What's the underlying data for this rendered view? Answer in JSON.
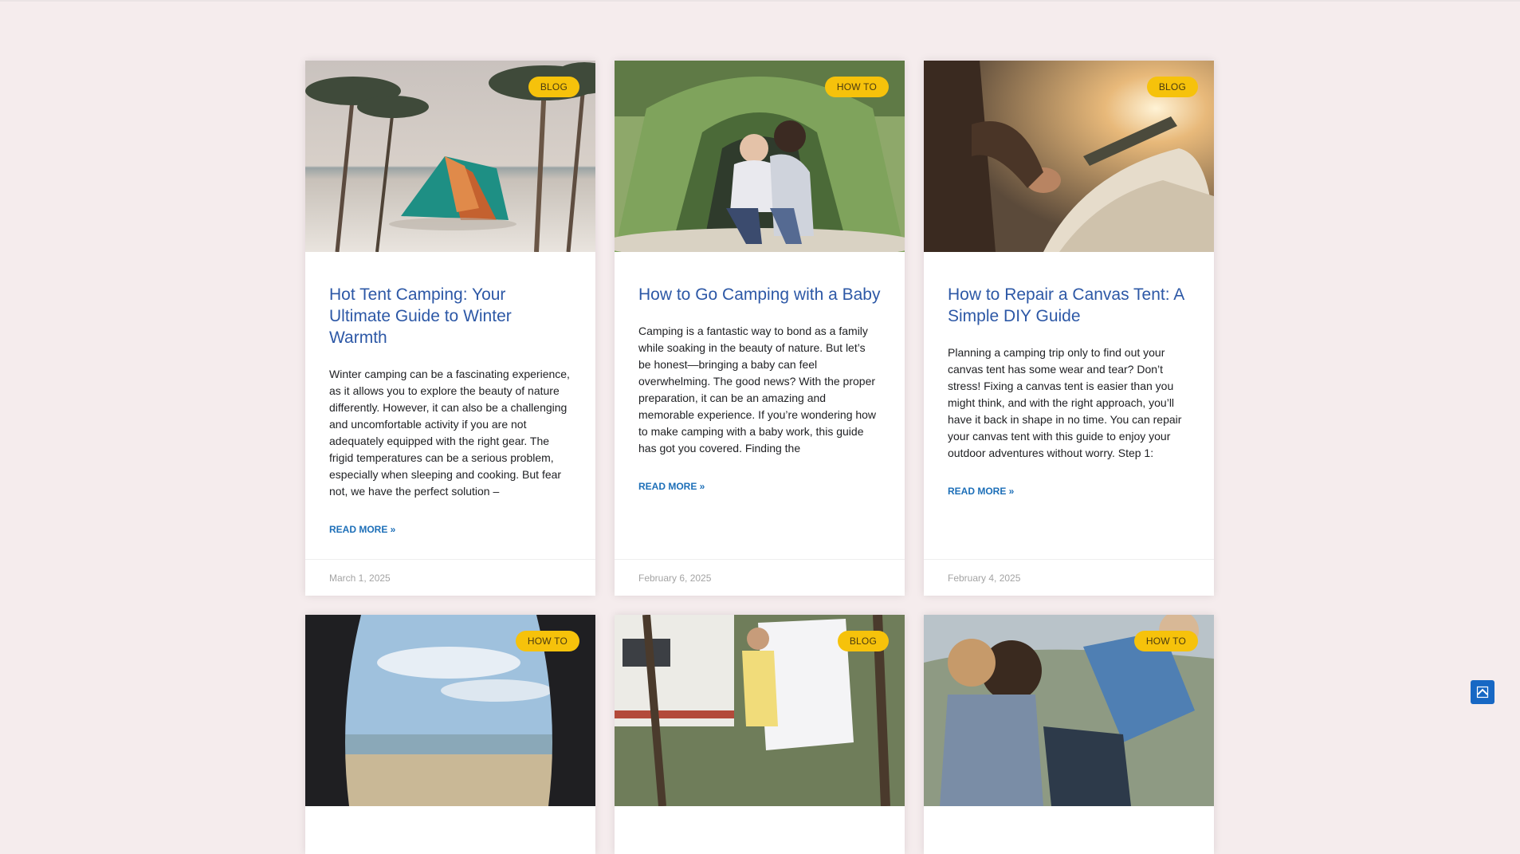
{
  "posts": [
    {
      "category": "BLOG",
      "title": "Hot Tent Camping: Your Ultimate Guide to Winter Warmth",
      "excerpt": "Winter camping can be a fascinating experience, as it allows you to explore the beauty of nature differently. However, it can also be a challenging and uncomfortable activity if you are not adequately equipped with the right gear. The frigid temperatures can be a serious problem, especially when sleeping and cooking. But fear not, we have the perfect solution –",
      "read_more": "READ MORE »",
      "date": "March 1, 2025",
      "image": "tent-on-beach-photo"
    },
    {
      "category": "HOW TO",
      "title": "How to Go Camping with a Baby",
      "excerpt": "Camping is a fantastic way to bond as a family while soaking in the beauty of nature. But let’s be honest—bringing a baby can feel overwhelming. The good news? With the proper preparation, it can be an amazing and memorable experience. If you’re wondering how to make camping with a baby work, this guide has got you covered. Finding the",
      "read_more": "READ MORE »",
      "date": "February 6, 2025",
      "image": "mother-and-child-in-tent-photo"
    },
    {
      "category": "BLOG",
      "title": "How to Repair a Canvas Tent: A Simple DIY Guide",
      "excerpt": "Planning a camping trip only to find out your canvas tent has some wear and tear? Don’t stress! Fixing a canvas tent is easier than you might think, and with the right approach, you’ll have it back in shape in no time. You can repair your canvas tent with this guide to enjoy your outdoor adventures without worry. Step 1:",
      "read_more": "READ MORE »",
      "date": "February 4, 2025",
      "image": "canvas-tent-sunset-photo"
    },
    {
      "category": "HOW TO",
      "image": "view-from-tent-photo"
    },
    {
      "category": "BLOG",
      "image": "laundry-by-caravan-photo"
    },
    {
      "category": "HOW TO",
      "image": "hikers-group-photo"
    }
  ],
  "icons": {
    "back_to_top": "chevron-up-icon"
  },
  "colors": {
    "background": "#f5eced",
    "badge": "#f6c20b",
    "title": "#2d58a6",
    "read_more": "#1d6fb8",
    "back_to_top": "#1768c4"
  }
}
